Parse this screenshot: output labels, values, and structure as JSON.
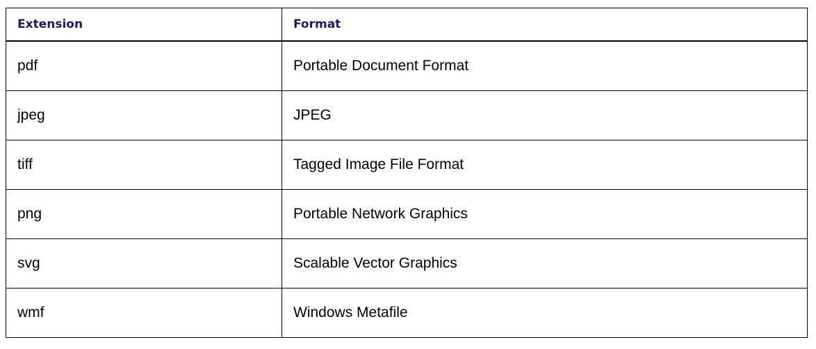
{
  "table": {
    "columns": [
      "Extension",
      "Format"
    ],
    "rows": [
      [
        "pdf",
        "Portable Document Format"
      ],
      [
        "jpeg",
        "JPEG"
      ],
      [
        "tiff",
        "Tagged Image File Format"
      ],
      [
        "png",
        "Portable Network Graphics"
      ],
      [
        "svg",
        "Scalable Vector Graphics"
      ],
      [
        "wmf",
        "Windows Metafile"
      ]
    ]
  },
  "colors": {
    "header_text": "#1a1a66",
    "body_text": "#000000",
    "border": "#000000"
  }
}
